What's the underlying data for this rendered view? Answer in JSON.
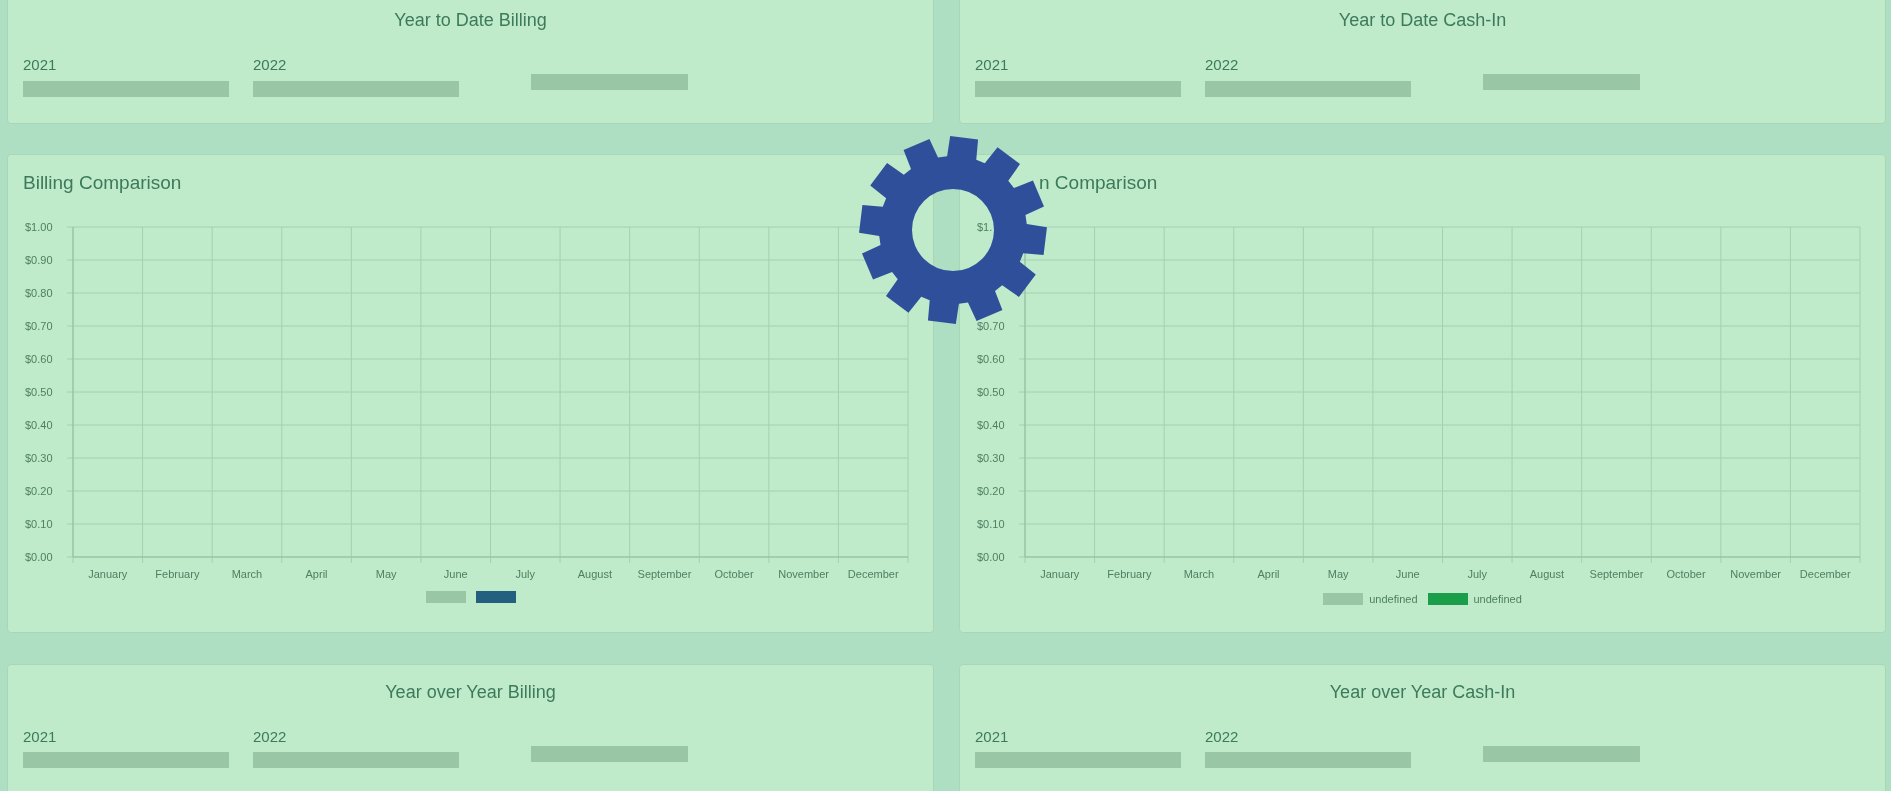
{
  "top_cards": [
    {
      "title": "Year to Date Billing",
      "labels": [
        "2021",
        "2022"
      ]
    },
    {
      "title": "Year to Date Cash-In",
      "labels": [
        "2021",
        "2022"
      ]
    }
  ],
  "chart_cards": [
    {
      "title": "Billing Comparison",
      "chart_data": {
        "type": "bar",
        "grid": true,
        "categories": [
          "January",
          "February",
          "March",
          "April",
          "May",
          "June",
          "July",
          "August",
          "September",
          "October",
          "November",
          "December"
        ],
        "ylim": [
          0,
          1
        ],
        "yticks": [
          {
            "value": 0,
            "label": "$0.00"
          },
          {
            "value": 0.1,
            "label": "$0.10"
          },
          {
            "value": 0.2,
            "label": "$0.20"
          },
          {
            "value": 0.3,
            "label": "$0.30"
          },
          {
            "value": 0.4,
            "label": "$0.40"
          },
          {
            "value": 0.5,
            "label": "$0.50"
          },
          {
            "value": 0.6,
            "label": "$0.60"
          },
          {
            "value": 0.7,
            "label": "$0.70"
          },
          {
            "value": 0.8,
            "label": "$0.80"
          },
          {
            "value": 0.9,
            "label": "$0.90"
          },
          {
            "value": 1,
            "label": "$1.00"
          }
        ],
        "series": [
          {
            "color": "#99c7a6",
            "values": [
              null,
              null,
              null,
              null,
              null,
              null,
              null,
              null,
              null,
              null,
              null,
              null
            ]
          },
          {
            "color": "#245f80",
            "values": [
              null,
              null,
              null,
              null,
              null,
              null,
              null,
              null,
              null,
              null,
              null,
              null
            ]
          }
        ]
      }
    },
    {
      "title": "n Comparison",
      "chart_data": {
        "type": "bar",
        "grid": true,
        "categories": [
          "January",
          "February",
          "March",
          "April",
          "May",
          "June",
          "July",
          "August",
          "September",
          "October",
          "November",
          "December"
        ],
        "ylim": [
          0,
          1
        ],
        "yticks": [
          {
            "value": 0,
            "label": "$0.00"
          },
          {
            "value": 0.1,
            "label": "$0.10"
          },
          {
            "value": 0.2,
            "label": "$0.20"
          },
          {
            "value": 0.3,
            "label": "$0.30"
          },
          {
            "value": 0.4,
            "label": "$0.40"
          },
          {
            "value": 0.5,
            "label": "$0.50"
          },
          {
            "value": 0.6,
            "label": "$0.60"
          },
          {
            "value": 0.7,
            "label": "$0.70"
          },
          {
            "value": 1,
            "label": "$1."
          }
        ],
        "series": [
          {
            "name": "undefined",
            "color": "#99c7a6",
            "values": [
              null,
              null,
              null,
              null,
              null,
              null,
              null,
              null,
              null,
              null,
              null,
              null
            ]
          },
          {
            "name": "undefined",
            "color": "#1a9e4a",
            "values": [
              null,
              null,
              null,
              null,
              null,
              null,
              null,
              null,
              null,
              null,
              null,
              null
            ]
          }
        ]
      }
    }
  ],
  "bottom_cards": [
    {
      "title": "Year over Year Billing",
      "labels": [
        "2021",
        "2022"
      ]
    },
    {
      "title": "Year over Year Cash-In",
      "labels": [
        "2021",
        "2022"
      ]
    }
  ]
}
